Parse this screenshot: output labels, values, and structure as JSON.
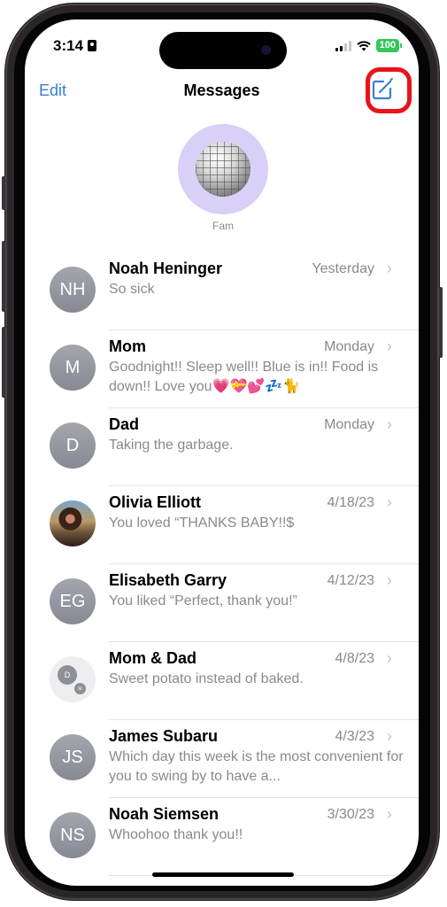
{
  "status_bar": {
    "time": "3:14",
    "battery": "100",
    "battery_color": "#34c759"
  },
  "nav": {
    "edit_label": "Edit",
    "title": "Messages",
    "compose_icon": "square-and-pencil-icon",
    "accent_color": "#3a7fd0",
    "highlight_color": "#e8131b"
  },
  "pinned": {
    "label": "Fam",
    "avatar_icon": "disco-ball-icon"
  },
  "conversations": [
    {
      "initials": "NH",
      "name": "Noah Heninger",
      "date": "Yesterday",
      "preview": "So sick"
    },
    {
      "initials": "M",
      "name": "Mom",
      "date": "Monday",
      "preview": "Goodnight!! Sleep well!! Blue is in!! Food is down!! Love you💗💝💕💤🐈"
    },
    {
      "initials": "D",
      "name": "Dad",
      "date": "Monday",
      "preview": "Taking the garbage."
    },
    {
      "initials": "",
      "name": "Olivia Elliott",
      "date": "4/18/23",
      "preview": "You loved “THANKS BABY!!$"
    },
    {
      "initials": "EG",
      "name": "Elisabeth Garry",
      "date": "4/12/23",
      "preview": "You liked “Perfect, thank you!”"
    },
    {
      "initials": "D",
      "initials_secondary": "M",
      "name": "Mom & Dad",
      "date": "4/8/23",
      "preview": "Sweet potato instead of baked."
    },
    {
      "initials": "JS",
      "name": "James Subaru",
      "date": "4/3/23",
      "preview": "Which day this week is the most convenient for you to swing by to have a..."
    },
    {
      "initials": "NS",
      "name": "Noah Siemsen",
      "date": "3/30/23",
      "preview": "Whoohoo thank you!!"
    }
  ],
  "chevron": "›"
}
